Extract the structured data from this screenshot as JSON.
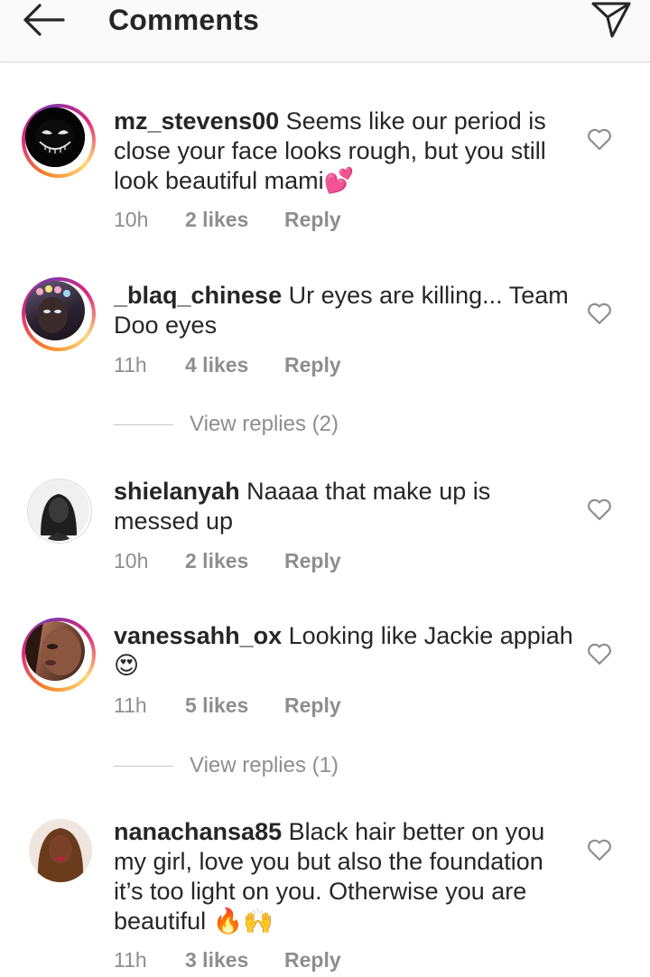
{
  "header": {
    "title": "Comments",
    "back_icon": "arrow-left-icon",
    "share_icon": "paper-plane-icon"
  },
  "comments": [
    {
      "username": "mz_stevens00",
      "text": " Seems like our period is close your face looks rough, but you still look beautiful mami",
      "emoji": "💕",
      "time": "10h",
      "likes": "2 likes",
      "reply": "Reply"
    },
    {
      "username": "_blaq_chinese",
      "text": " Ur eyes are killing... Team Doo eyes",
      "emoji": "",
      "time": "11h",
      "likes": "4 likes",
      "reply": "Reply",
      "view_replies": "View replies (2)"
    },
    {
      "username": "shielanyah",
      "text": " Naaaa that make up is messed up",
      "emoji": "",
      "time": "10h",
      "likes": "2 likes",
      "reply": "Reply"
    },
    {
      "username": "vanessahh_ox",
      "text": " Looking like Jackie appiah ",
      "emoji": "😍",
      "time": "11h",
      "likes": "5 likes",
      "reply": "Reply",
      "view_replies": "View replies (1)"
    },
    {
      "username": "nanachansa85",
      "text": " Black hair better on you my girl, love you but also the foundation it’s too light on you. Otherwise you are beautiful ",
      "emoji": "🔥🙌",
      "time": "11h",
      "likes": "3 likes",
      "reply": "Reply"
    }
  ],
  "colors": {
    "text": "#262626",
    "meta": "#8e8e8e",
    "header_bg": "#fafafa",
    "story_ring_start": "#f58529",
    "story_ring_end": "#8134af"
  }
}
